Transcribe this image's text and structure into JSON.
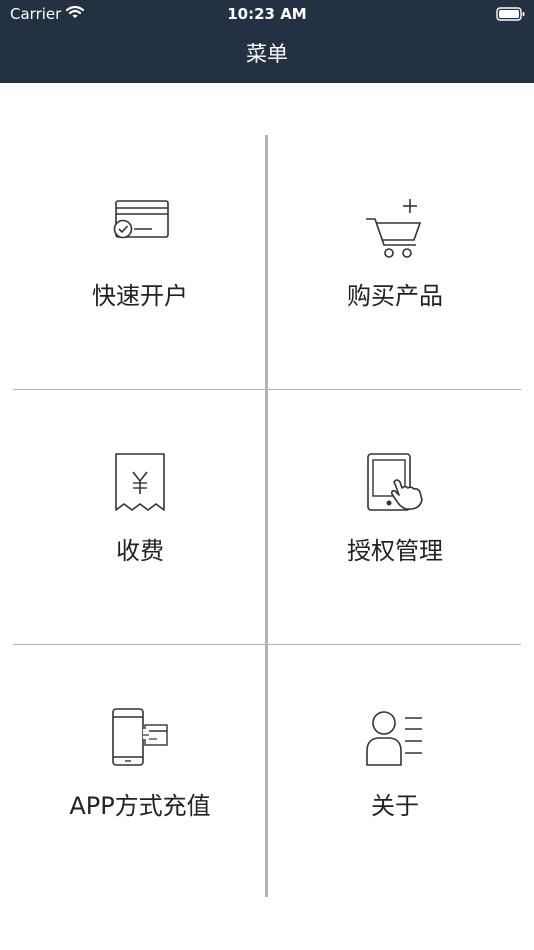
{
  "status_bar": {
    "carrier": "Carrier",
    "time": "10:23 AM"
  },
  "nav": {
    "title": "菜单"
  },
  "menu": {
    "items": [
      {
        "label": "快速开户",
        "icon": "card-check-icon"
      },
      {
        "label": "购买产品",
        "icon": "cart-add-icon"
      },
      {
        "label": "收费",
        "icon": "receipt-yuan-icon"
      },
      {
        "label": "授权管理",
        "icon": "tablet-touch-icon"
      },
      {
        "label": "APP方式充值",
        "icon": "phone-card-icon"
      },
      {
        "label": "关于",
        "icon": "user-profile-icon"
      }
    ]
  },
  "colors": {
    "header_bg": "#233142",
    "divider": "#b4b4b4",
    "text": "#222222",
    "icon": "#333333"
  }
}
